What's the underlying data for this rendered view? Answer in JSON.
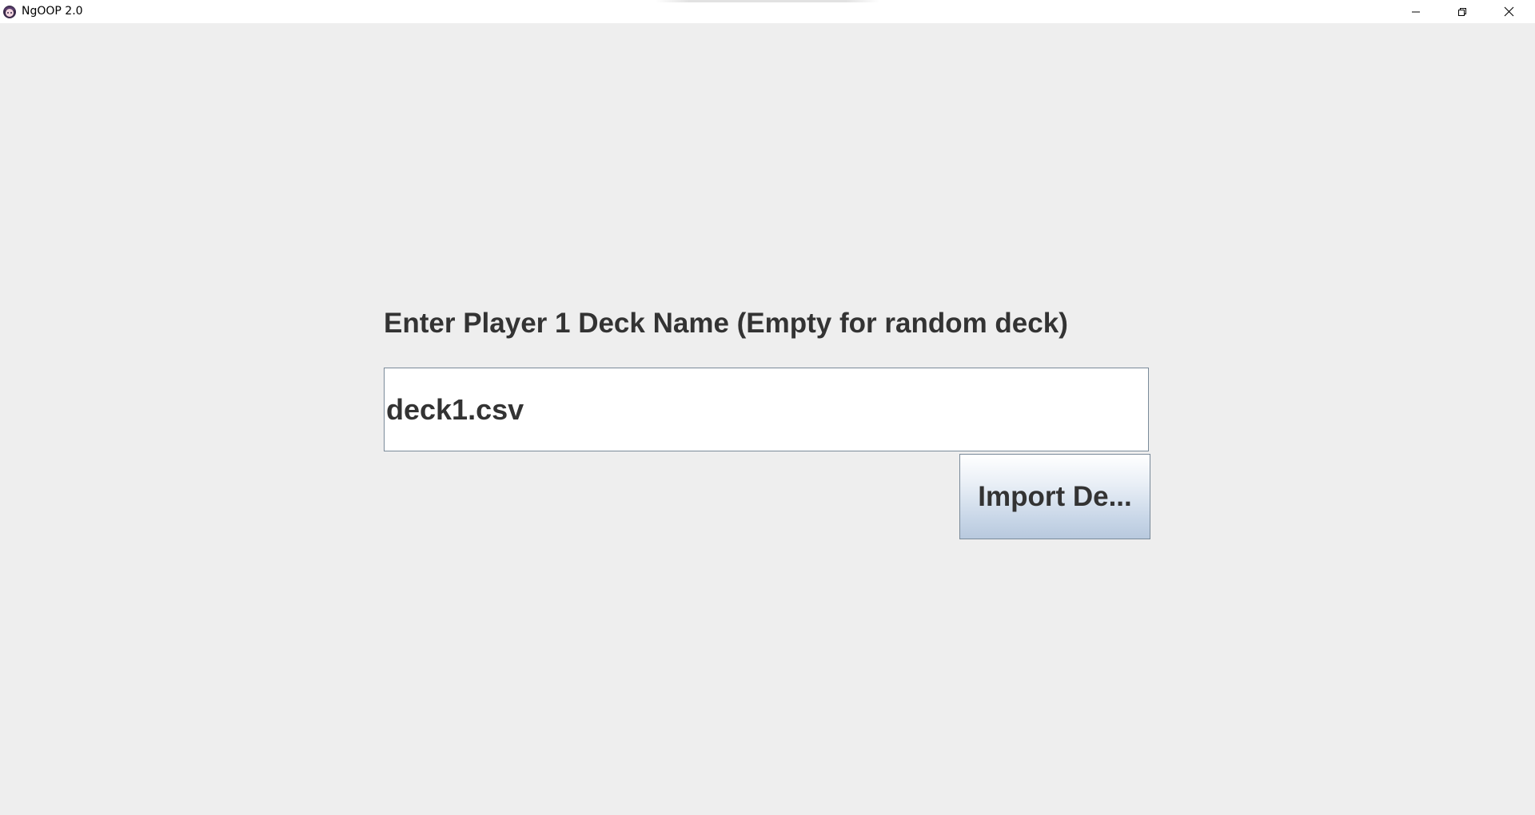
{
  "window": {
    "title": "NgOOP 2.0",
    "icon": "app-logo-icon",
    "controls": [
      "minimize-icon",
      "restore-icon",
      "close-icon"
    ]
  },
  "form": {
    "prompt": "Enter Player 1 Deck Name (Empty for random deck)",
    "deck_input_value": "deck1.csv",
    "import_button_label": "Import De..."
  },
  "colors": {
    "background": "#eeeeee",
    "text": "#333333",
    "input_border": "#7a8a99",
    "button_gradient_bottom": "#b8c9de"
  }
}
